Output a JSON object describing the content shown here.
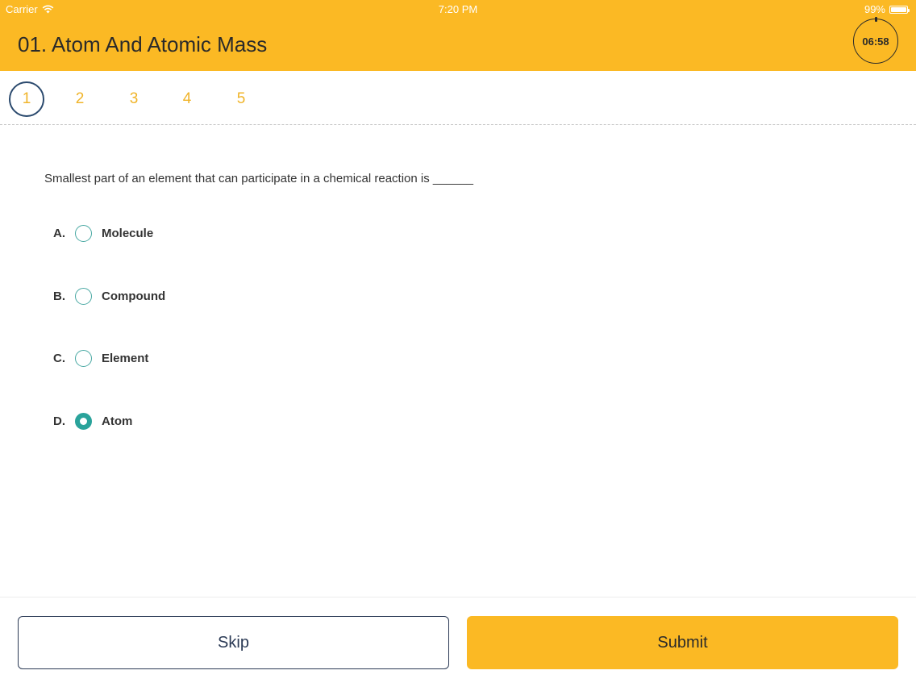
{
  "status_bar": {
    "carrier": "Carrier",
    "time": "7:20 PM",
    "battery": "99%",
    "wifi_icon": "wifi-icon",
    "battery_icon": "battery-icon"
  },
  "header": {
    "title": "01. Atom And Atomic Mass",
    "timer": "06:58",
    "background_color": "#fbb924"
  },
  "question_nav": {
    "items": [
      {
        "label": "1",
        "active": true
      },
      {
        "label": "2",
        "active": false
      },
      {
        "label": "3",
        "active": false
      },
      {
        "label": "4",
        "active": false
      },
      {
        "label": "5",
        "active": false
      }
    ]
  },
  "question": {
    "text": "Smallest part of an element that can participate in a chemical reaction is ______",
    "options": [
      {
        "letter": "A.",
        "label": "Molecule",
        "selected": false
      },
      {
        "letter": "B.",
        "label": "Compound",
        "selected": false
      },
      {
        "letter": "C.",
        "label": "Element",
        "selected": false
      },
      {
        "letter": "D.",
        "label": "Atom",
        "selected": true
      }
    ]
  },
  "footer": {
    "skip_label": "Skip",
    "submit_label": "Submit"
  },
  "colors": {
    "accent": "#fbb924",
    "radio": "#2aa39b",
    "nav_number": "#f0b429",
    "active_ring": "#2b4a6e"
  }
}
